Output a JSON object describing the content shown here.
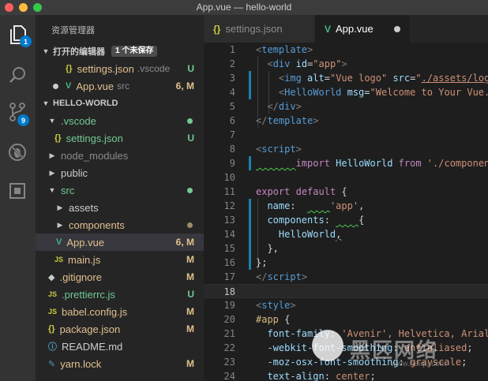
{
  "window": {
    "title": "App.vue — hello-world"
  },
  "activity_bar": {
    "explorer_badge": "1",
    "scm_badge": "9"
  },
  "sidebar": {
    "title": "资源管理器",
    "open_editors": {
      "label": "打开的编辑器",
      "unsaved_count": "1 个未保存",
      "items": [
        {
          "name": "settings.json",
          "folder": ".vscode",
          "status": "U"
        },
        {
          "name": "App.vue",
          "folder": "src",
          "status": "6, M"
        }
      ]
    },
    "project": {
      "label": "HELLO-WORLD",
      "tree": [
        {
          "name": ".vscode",
          "status": ""
        },
        {
          "name": "settings.json",
          "status": "U"
        },
        {
          "name": "node_modules",
          "status": ""
        },
        {
          "name": "public",
          "status": ""
        },
        {
          "name": "src",
          "status": ""
        },
        {
          "name": "assets",
          "status": ""
        },
        {
          "name": "components",
          "status": ""
        },
        {
          "name": "App.vue",
          "status": "6, M"
        },
        {
          "name": "main.js",
          "status": "M"
        },
        {
          "name": ".gitignore",
          "status": "M"
        },
        {
          "name": ".prettierrc.js",
          "status": "U"
        },
        {
          "name": "babel.config.js",
          "status": "M"
        },
        {
          "name": "package.json",
          "status": "M"
        },
        {
          "name": "README.md",
          "status": ""
        },
        {
          "name": "yarn.lock",
          "status": "M"
        }
      ]
    }
  },
  "tabs": [
    {
      "label": "settings.json",
      "icon": "{}"
    },
    {
      "label": "App.vue",
      "icon": "V"
    }
  ],
  "editor": {
    "line_numbers": [
      "1",
      "2",
      "3",
      "4",
      "5",
      "6",
      "7",
      "8",
      "9",
      "10",
      "11",
      "12",
      "13",
      "14",
      "15",
      "16",
      "17",
      "18",
      "19",
      "20",
      "21",
      "22",
      "23",
      "24"
    ],
    "lines": {
      "l1": [
        "<",
        "template",
        ">"
      ],
      "l2": [
        "  <",
        "div",
        " ",
        "id",
        "=",
        "\"app\"",
        ">"
      ],
      "l3": [
        "    <",
        "img",
        " ",
        "alt",
        "=",
        "\"Vue logo\"",
        " ",
        "src",
        "=",
        "\"",
        "./assets/logo.png"
      ],
      "l4": [
        "    <",
        "HelloWorld",
        " ",
        "msg",
        "=",
        "\"Welcome to Your Vue.js App\""
      ],
      "l5": [
        "  </",
        "div",
        ">"
      ],
      "l6": [
        "</",
        "template",
        ">"
      ],
      "l7": [
        ""
      ],
      "l8": [
        "<",
        "script",
        ">"
      ],
      "l9": [
        "       ",
        "import",
        " ",
        "HelloWorld",
        " ",
        "from",
        " ",
        "'./components/HelloWorld.vue'"
      ],
      "l10": [
        ""
      ],
      "l11": [
        "export",
        " ",
        "default",
        " {"
      ],
      "l12": [
        "  ",
        "name",
        ":  ",
        "    ",
        "'app'",
        ","
      ],
      "l13": [
        "  ",
        "components",
        ": ",
        "    ",
        "{"
      ],
      "l14": [
        "    ",
        "HelloWorld",
        ","
      ],
      "l15": [
        "  },"
      ],
      "l16": [
        "};"
      ],
      "l17": [
        "</",
        "script",
        ">"
      ],
      "l18": [
        ""
      ],
      "l19": [
        "<",
        "style",
        ">"
      ],
      "l20": [
        "#app",
        " {"
      ],
      "l21": [
        "  ",
        "font-family",
        ": ",
        "'Avenir'",
        ", Helvetica, Arial, sans-serif;"
      ],
      "l22": [
        "  ",
        "-webkit-font-smoothing",
        ": ",
        "antialiased",
        ";"
      ],
      "l23": [
        "  ",
        "-moz-osx-font-smoothing",
        ": ",
        "grayscale",
        ";"
      ],
      "l24": [
        "  ",
        "text-align",
        ": ",
        "center",
        ";"
      ]
    }
  },
  "watermark": {
    "brand": "黑区网络",
    "url": "www.heiqu.com"
  },
  "colors": {
    "accent": "#007acc",
    "untracked": "#73c991",
    "modified": "#e2c08d",
    "tag": "#569cd6",
    "string": "#ce9178",
    "keyword": "#c586c0",
    "attribute": "#9cdcfe"
  }
}
